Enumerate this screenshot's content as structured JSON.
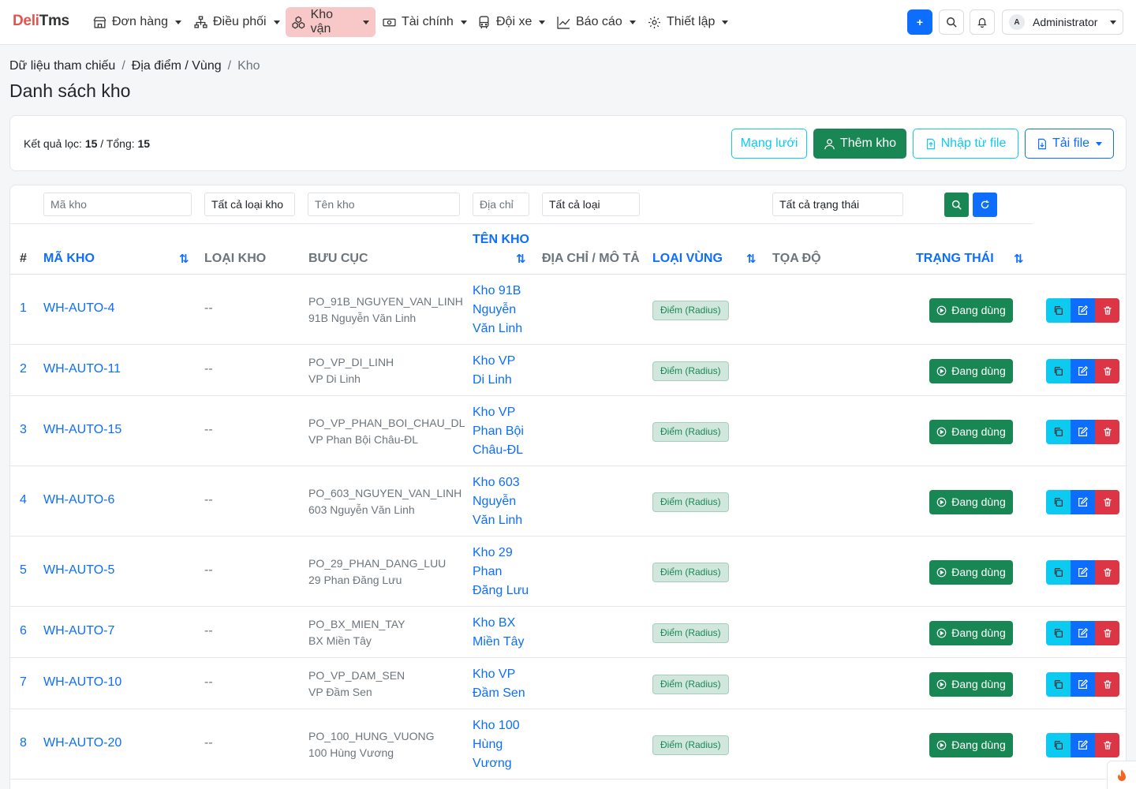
{
  "brand": {
    "part1": "Deli",
    "part2": "Tms"
  },
  "nav": {
    "items": [
      {
        "label": "Đơn hàng",
        "icon": "shop-icon"
      },
      {
        "label": "Điều phối",
        "icon": "diagram-icon"
      },
      {
        "label": "Kho vận",
        "icon": "boxes-icon"
      },
      {
        "label": "Tài chính",
        "icon": "cash-icon"
      },
      {
        "label": "Đội xe",
        "icon": "bus-icon"
      },
      {
        "label": "Báo cáo",
        "icon": "chart-icon"
      },
      {
        "label": "Thiết lập",
        "icon": "gear-icon"
      }
    ],
    "add_label": "+",
    "user": {
      "initial": "A",
      "name": "Administrator"
    }
  },
  "breadcrumb": {
    "l1": "Dữ liệu tham chiếu",
    "l2": "Địa điểm / Vùng",
    "l3": "Kho"
  },
  "page": {
    "title": "Danh sách kho"
  },
  "summary": {
    "filtered_label": "Kết quả lọc:",
    "filtered": "15",
    "total_label": "/ Tổng:",
    "total": "15"
  },
  "actions": {
    "network": "Mạng lưới",
    "add": "Thêm kho",
    "import": "Nhập từ file",
    "download": "Tải file"
  },
  "filters": {
    "code_placeholder": "Mã kho",
    "type": "Tất cả loại kho",
    "name_placeholder": "Tên kho",
    "address_placeholder": "Địa chỉ",
    "zone": "Tất cả loại",
    "status": "Tất cả trạng thái"
  },
  "columns": {
    "idx": "#",
    "code": "Mã kho",
    "type": "Loại kho",
    "po": "Bưu cục",
    "name": "Tên kho",
    "address": "Địa chỉ / Mô tả",
    "zone": "Loại vùng",
    "coords": "Tọa độ",
    "status": "Trạng thái"
  },
  "rows": [
    {
      "idx": "1",
      "code": "WH-AUTO-4",
      "type": "--",
      "po_code": "PO_91B_NGUYEN_VAN_LINH",
      "po_name": "91B Nguyễn Văn Linh",
      "name_lines": [
        "Kho 91B",
        "Nguyễn",
        "Văn Linh"
      ],
      "zone": "Điểm (Radius)",
      "status": "Đang dùng"
    },
    {
      "idx": "2",
      "code": "WH-AUTO-11",
      "type": "--",
      "po_code": "PO_VP_DI_LINH",
      "po_name": "VP Di Linh",
      "name_lines": [
        "Kho VP",
        "Di Linh"
      ],
      "zone": "Điểm (Radius)",
      "status": "Đang dùng"
    },
    {
      "idx": "3",
      "code": "WH-AUTO-15",
      "type": "--",
      "po_code": "PO_VP_PHAN_BOI_CHAU_DL",
      "po_name": "VP Phan Bội Châu-ĐL",
      "name_lines": [
        "Kho VP",
        "Phan Bội",
        "Châu-ĐL"
      ],
      "zone": "Điểm (Radius)",
      "status": "Đang dùng"
    },
    {
      "idx": "4",
      "code": "WH-AUTO-6",
      "type": "--",
      "po_code": "PO_603_NGUYEN_VAN_LINH",
      "po_name": "603 Nguyễn Văn Linh",
      "name_lines": [
        "Kho 603",
        "Nguyễn",
        "Văn Linh"
      ],
      "zone": "Điểm (Radius)",
      "status": "Đang dùng"
    },
    {
      "idx": "5",
      "code": "WH-AUTO-5",
      "type": "--",
      "po_code": "PO_29_PHAN_DANG_LUU",
      "po_name": "29 Phan Đăng Lưu",
      "name_lines": [
        "Kho 29",
        "Phan",
        "Đăng Lưu"
      ],
      "zone": "Điểm (Radius)",
      "status": "Đang dùng"
    },
    {
      "idx": "6",
      "code": "WH-AUTO-7",
      "type": "--",
      "po_code": "PO_BX_MIEN_TAY",
      "po_name": "BX Miền Tây",
      "name_lines": [
        "Kho BX",
        "Miền Tây"
      ],
      "zone": "Điểm (Radius)",
      "status": "Đang dùng"
    },
    {
      "idx": "7",
      "code": "WH-AUTO-10",
      "type": "--",
      "po_code": "PO_VP_DAM_SEN",
      "po_name": "VP Đầm Sen",
      "name_lines": [
        "Kho VP",
        "Đầm Sen"
      ],
      "zone": "Điểm (Radius)",
      "status": "Đang dùng"
    },
    {
      "idx": "8",
      "code": "WH-AUTO-20",
      "type": "--",
      "po_code": "PO_100_HUNG_VUONG",
      "po_name": "100 Hùng Vương",
      "name_lines": [
        "Kho 100",
        "Hùng",
        "Vương"
      ],
      "zone": "Điểm (Radius)",
      "status": "Đang dùng"
    }
  ]
}
